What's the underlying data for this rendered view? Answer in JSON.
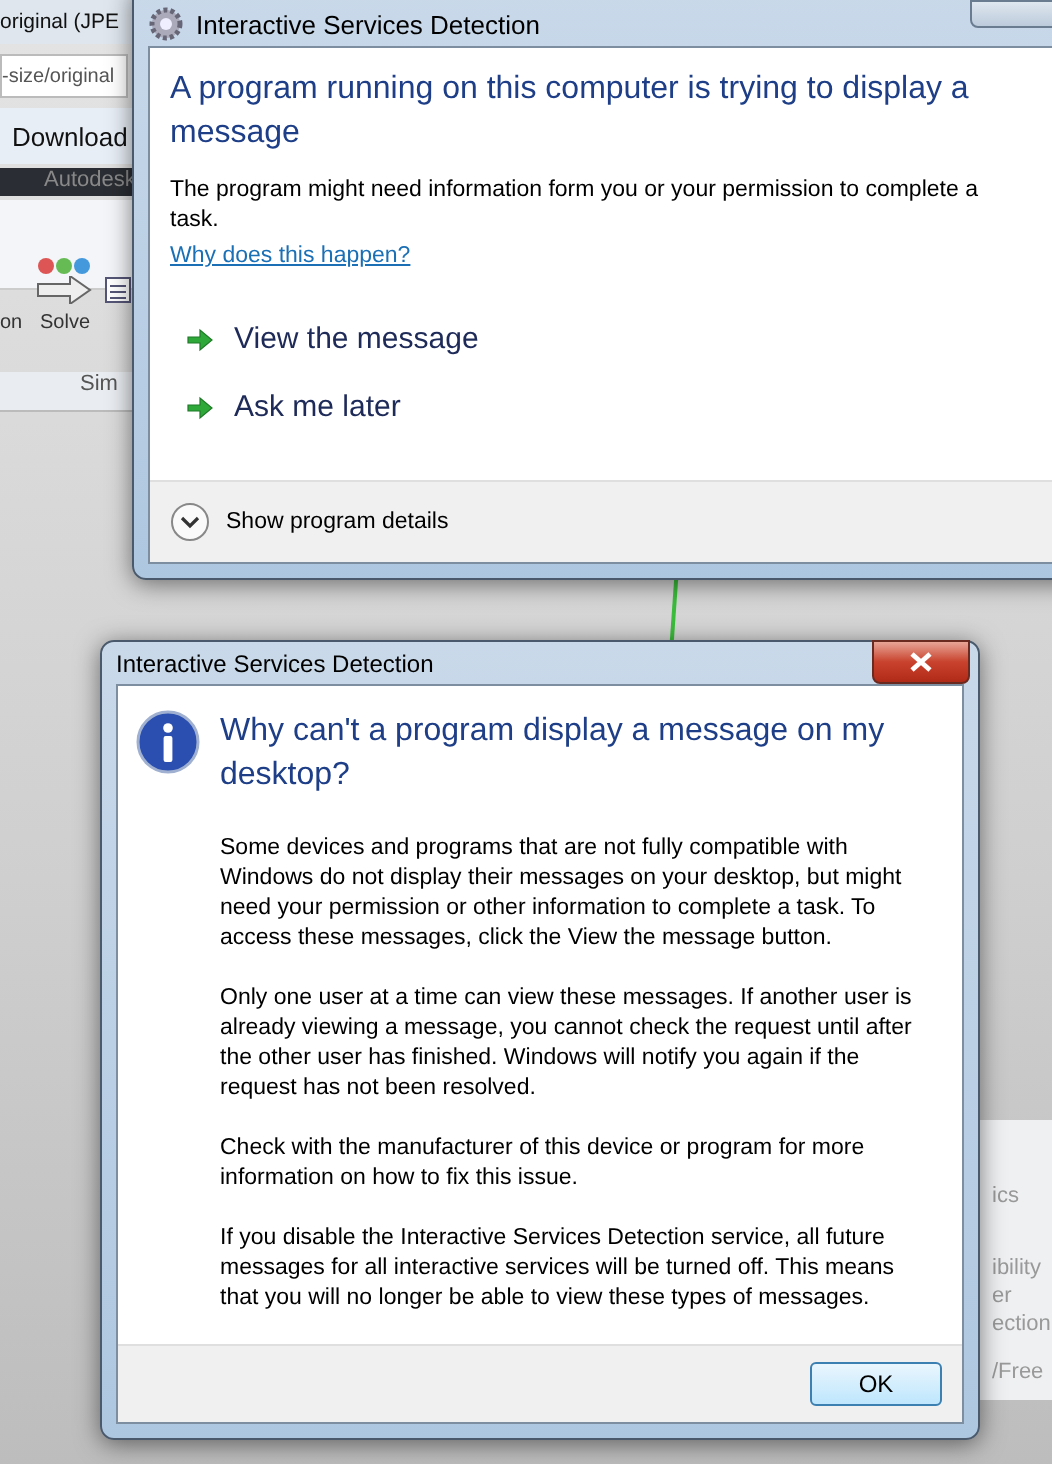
{
  "background": {
    "browser_tab": "original (JPE",
    "address": "-size/original",
    "toolbar_button": "Download",
    "app_title": "Autodesk",
    "ribbon_labels": [
      "on",
      "Solve"
    ],
    "ribbon_group": "Sim",
    "side_panel": [
      "ics",
      "ibility",
      "er",
      "ection"
    ],
    "status": "/Free"
  },
  "prompt_dialog": {
    "title": "Interactive Services Detection",
    "heading": "A program running on this computer is trying to display a message",
    "body": "The program might need information form you or your permission to complete a task.",
    "link": "Why does this happen?",
    "commands": [
      "View the message",
      "Ask me later"
    ],
    "details": {
      "label": "Show program details",
      "expanded": false
    }
  },
  "help_dialog": {
    "title": "Interactive Services Detection",
    "heading": "Why can't a program display a message on my desktop?",
    "paragraphs": [
      "Some devices and programs that are not fully compatible with Windows do not display their messages on your desktop, but might need your permission or other information to complete a task. To access these messages, click the View the message button.",
      "Only one user at a time can view these messages. If another user is already viewing a message, you cannot check the request until after the other user has finished. Windows will notify you again if the request has not been resolved.",
      "Check with the manufacturer of this device or program for more information on how to fix this issue.",
      "If you disable the Interactive Services Detection service, all future messages for all interactive services will be turned off. This means that you will no longer be able to view these types of messages."
    ],
    "button": "OK"
  }
}
